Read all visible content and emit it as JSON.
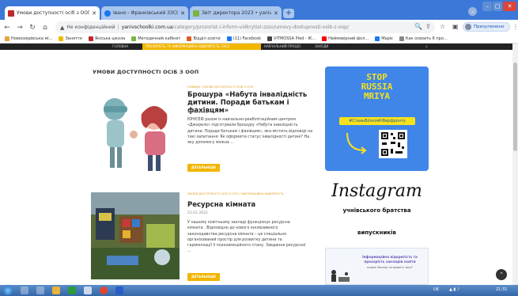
{
  "browser": {
    "tabs": [
      {
        "title": "Умови доступності осіб з ООП",
        "favicon_color": "#c0262d",
        "active": true
      },
      {
        "title": "Івано - Франківський ЗЗСО І - ІІ",
        "favicon_color": "#1877f2",
        "active": false
      },
      {
        "title": "Звіт директора 2023 • yanivsc",
        "favicon_color": "#7cb342",
        "active": false
      }
    ],
    "new_tab_icon": "+",
    "address": {
      "not_secure": "Не конфіденційний",
      "host": "yanivschoolki.com.ua",
      "path": "/category/prozorist-i-inform-vidkrytist-zzso/umovy-dostupnosti-osib-z-oop/"
    },
    "profile_status": "Призупинено"
  },
  "bookmarks": [
    {
      "label": "Новоозерівська мі...",
      "color": "#e8a33b"
    },
    {
      "label": "Заняття",
      "color": "#f2b500"
    },
    {
      "label": "Яніська школа",
      "color": "#c0262d"
    },
    {
      "label": "Методичний кабінет",
      "color": "#7cb342"
    },
    {
      "label": "Відділ освіти",
      "color": "#e05a24"
    },
    {
      "label": "(11) Facebook",
      "color": "#1877f2"
    },
    {
      "label": "VITMOSSA Pled - ІК...",
      "color": "#444444"
    },
    {
      "label": "Неймовірний фол...",
      "color": "#ff0000"
    },
    {
      "label": "Маріє",
      "color": "#1877f2"
    },
    {
      "label": "Как освоить 6 про...",
      "color": "#888888"
    }
  ],
  "site": {
    "nav_items": [
      "ГОЛОВНА",
      "ПРОЗОРІСТЬ ТА ІНФОРМАЦІЙНА ВІДКРИТІСТЬ ЗЗСО",
      "НАВЧАЛЬНИЙ ПРОЦЕС",
      "ЗАХОДИ"
    ],
    "section_title": "УМОВИ ДОСТУПНОСТІ ОСІБ З ООП",
    "posts": [
      {
        "category": "НОВИНИ / УМОВИ ДОСТУПНОСТІ ОСІБ З ООП",
        "title": "Брошура «Набута інвалідність дитини. Поради батькам і фахівцям»",
        "date": "19.12.2022",
        "excerpt": "ЮНІСЕФ разом із навчально-реабілітаційним центром «Джерело» підготували брошуру «Набута інвалідність дитини. Поради батькам і фахівцям», яка містить відповіді на такі запитання: Як оформити статус інвалідності дитині? На яку допомогу можна ...",
        "button": "ДЕТАЛЬНІШЕ"
      },
      {
        "category": "УМОВИ ДОСТУПНОСТІ ОСІБ З ООП / ІНФОРМАЦІЙНА ВІДКРИТІСТЬ",
        "title": "Ресурсна кімната",
        "date": "23.01.2022",
        "excerpt": "У нашому освітньому закладі функціонує ресурсна кімната . Відповідно до нового інклюзивного законодавства ресурсна кімната – це спеціально організований простір для розвитку дитини та гармонізації її психоемоційного стану. Завдання ресурсної ...",
        "button": "ДЕТАЛЬНІШЕ"
      }
    ],
    "sidebar": {
      "banner_lines": [
        "STOP",
        "RUSSIA",
        "MRIYA"
      ],
      "banner_tag": "#СтаньВоїномКіберфронту",
      "instagram": "Instagram",
      "instagram_sub": "учнівського братства",
      "instagram_sub2": "випускників",
      "card_text": "Інформаційна відкритість та прозорість закладів освіти",
      "card_text2": "норма Закону чи вимога часу?"
    }
  },
  "taskbar": {
    "lang": "UK",
    "time": "21:31"
  }
}
